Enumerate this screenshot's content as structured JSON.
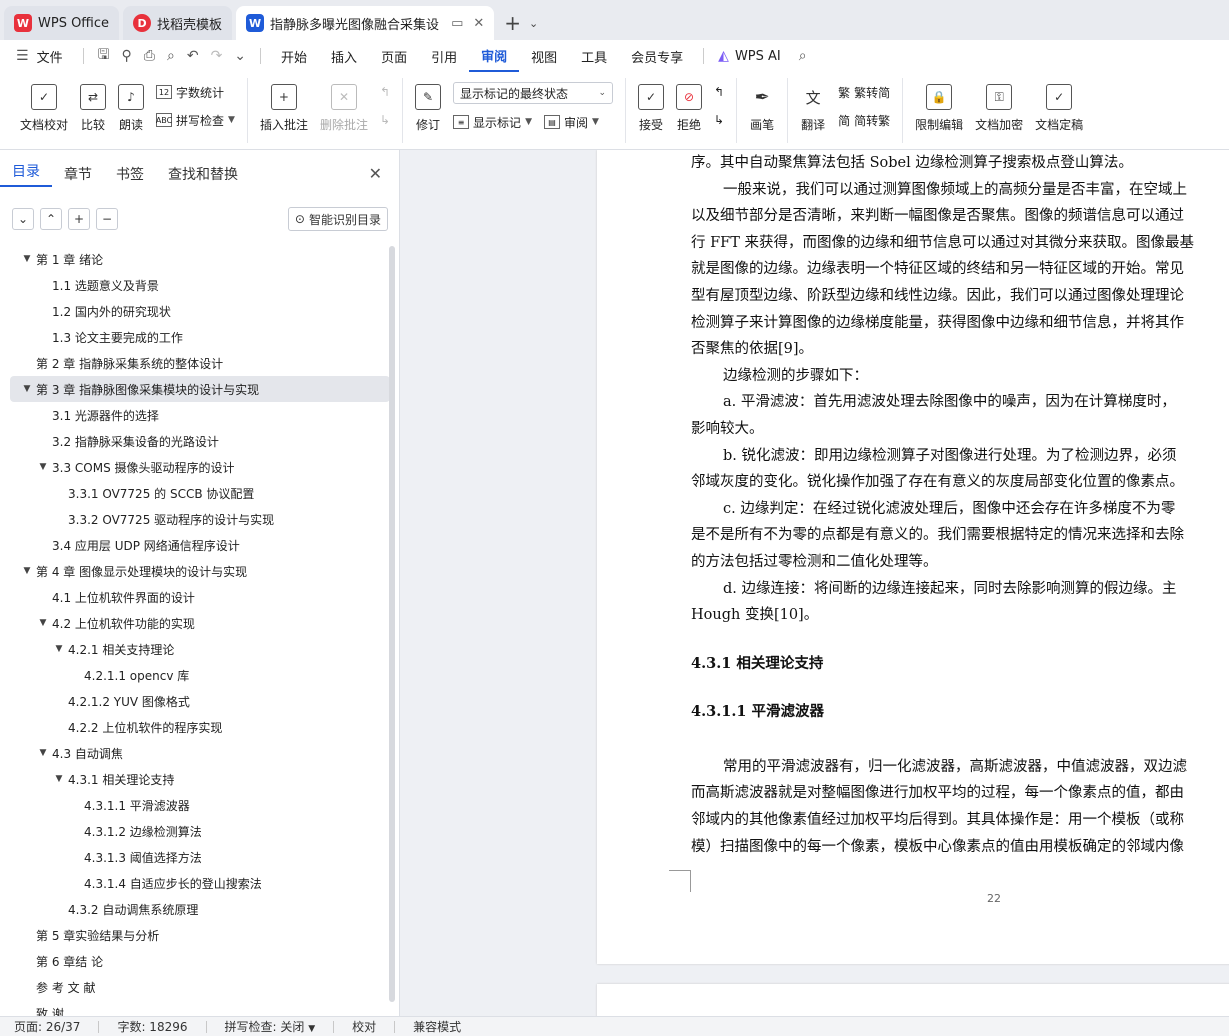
{
  "titlebar": {
    "tabs": [
      {
        "label": "WPS Office",
        "icon": "wps-logo-icon"
      },
      {
        "label": "找稻壳模板",
        "icon": "docer-logo-icon"
      },
      {
        "label": "指静脉多曝光图像融合采集设",
        "icon": "wps-writer-icon"
      }
    ],
    "new_tab": "+"
  },
  "menubar": {
    "file": "文件",
    "items": [
      "开始",
      "插入",
      "页面",
      "引用",
      "审阅",
      "视图",
      "工具",
      "会员专享"
    ],
    "active": "审阅",
    "ai": "WPS AI"
  },
  "ribbon": {
    "doc_check": "文档校对",
    "compare": "比较",
    "read_aloud": "朗读",
    "word_count": "字数统计",
    "spell_check": "拼写检查",
    "insert_comment": "插入批注",
    "delete_comment": "删除批注",
    "revise": "修订",
    "markup_state": "显示标记的最终状态",
    "show_markup": "显示标记",
    "review": "审阅",
    "accept": "接受",
    "reject": "拒绝",
    "pen": "画笔",
    "translate": "翻译",
    "trad_to_simp": "繁转简",
    "simp_to_trad": "简转繁",
    "restrict_edit": "限制编辑",
    "doc_encrypt": "文档加密",
    "doc_finalize": "文档定稿",
    "trad_char": "繁",
    "simp_char": "简"
  },
  "sidebar": {
    "tabs": [
      "目录",
      "章节",
      "书签",
      "查找和替换"
    ],
    "active_tab": "目录",
    "smart_toc": "智能识别目录",
    "toc": [
      {
        "level": 1,
        "arrow": "▼",
        "label": "第 1 章  绪论"
      },
      {
        "level": 2,
        "arrow": "",
        "label": "1.1  选题意义及背景"
      },
      {
        "level": 2,
        "arrow": "",
        "label": "1.2  国内外的研究现状"
      },
      {
        "level": 2,
        "arrow": "",
        "label": "1.3  论文主要完成的工作"
      },
      {
        "level": 1,
        "arrow": "",
        "label": "第 2 章  指静脉采集系统的整体设计"
      },
      {
        "level": 1,
        "arrow": "▼",
        "label": "第 3 章  指静脉图像采集模块的设计与实现",
        "selected": true
      },
      {
        "level": 2,
        "arrow": "",
        "label": "3.1  光源器件的选择"
      },
      {
        "level": 2,
        "arrow": "",
        "label": "3.2  指静脉采集设备的光路设计"
      },
      {
        "level": 2,
        "arrow": "▼",
        "label": "3.3 COMS 摄像头驱动程序的设计"
      },
      {
        "level": 3,
        "arrow": "",
        "label": "3.3.1 OV7725 的 SCCB 协议配置"
      },
      {
        "level": 3,
        "arrow": "",
        "label": "3.3.2 OV7725 驱动程序的设计与实现"
      },
      {
        "level": 2,
        "arrow": "",
        "label": "3.4  应用层 UDP 网络通信程序设计"
      },
      {
        "level": 1,
        "arrow": "▼",
        "label": "第 4 章  图像显示处理模块的设计与实现"
      },
      {
        "level": 2,
        "arrow": "",
        "label": "4.1  上位机软件界面的设计"
      },
      {
        "level": 2,
        "arrow": "▼",
        "label": "4.2  上位机软件功能的实现"
      },
      {
        "level": 3,
        "arrow": "▼",
        "label": "4.2.1  相关支持理论"
      },
      {
        "level": 4,
        "arrow": "",
        "label": "4.2.1.1 opencv 库"
      },
      {
        "level": 3,
        "arrow": "",
        "label": "4.2.1.2 YUV 图像格式"
      },
      {
        "level": 3,
        "arrow": "",
        "label": "4.2.2  上位机软件的程序实现"
      },
      {
        "level": 2,
        "arrow": "▼",
        "label": "4.3  自动调焦"
      },
      {
        "level": 3,
        "arrow": "▼",
        "label": "4.3.1  相关理论支持"
      },
      {
        "level": 4,
        "arrow": "",
        "label": "4.3.1.1  平滑滤波器"
      },
      {
        "level": 4,
        "arrow": "",
        "label": "4.3.1.2  边缘检测算法"
      },
      {
        "level": 4,
        "arrow": "",
        "label": "4.3.1.3  阈值选择方法"
      },
      {
        "level": 4,
        "arrow": "",
        "label": "4.3.1.4  自适应步长的登山搜索法"
      },
      {
        "level": 3,
        "arrow": "",
        "label": "4.3.2 自动调焦系统原理"
      },
      {
        "level": 1,
        "arrow": "",
        "label": "第 5 章实验结果与分析"
      },
      {
        "level": 1,
        "arrow": "",
        "label": "第 6 章结  论"
      },
      {
        "level": 1,
        "arrow": "",
        "label": "参  考  文  献"
      },
      {
        "level": 1,
        "arrow": "",
        "label": "致  谢"
      }
    ]
  },
  "document": {
    "lines": [
      {
        "text": "序。其中自动聚焦算法包括 Sobel 边缘检测算子搜索极点登山算法。",
        "indent": false
      },
      {
        "text": "一般来说，我们可以通过测算图像频域上的高频分量是否丰富，在空域上",
        "indent": true
      },
      {
        "text": "以及细节部分是否清晰，来判断一幅图像是否聚焦。图像的频谱信息可以通过",
        "indent": false
      },
      {
        "text": "行 FFT 来获得，而图像的边缘和细节信息可以通过对其微分来获取。图像最基",
        "indent": false
      },
      {
        "text": "就是图像的边缘。边缘表明一个特征区域的终结和另一特征区域的开始。常见",
        "indent": false
      },
      {
        "text": "型有屋顶型边缘、阶跃型边缘和线性边缘。因此，我们可以通过图像处理理论",
        "indent": false
      },
      {
        "text": "检测算子来计算图像的边缘梯度能量，获得图像中边缘和细节信息，并将其作",
        "indent": false
      },
      {
        "text": "否聚焦的依据[9]。",
        "indent": false
      },
      {
        "text": "边缘检测的步骤如下：",
        "indent": true
      },
      {
        "text": "a.  平滑滤波：首先用滤波处理去除图像中的噪声，因为在计算梯度时，",
        "indent": true
      },
      {
        "text": "影响较大。",
        "indent": false
      },
      {
        "text": "b.  锐化滤波：即用边缘检测算子对图像进行处理。为了检测边界，必须",
        "indent": true
      },
      {
        "text": "邻域灰度的变化。锐化操作加强了存在有意义的灰度局部变化位置的像素点。",
        "indent": false
      },
      {
        "text": "c.  边缘判定：在经过锐化滤波处理后，图像中还会存在许多梯度不为零",
        "indent": true
      },
      {
        "text": "是不是所有不为零的点都是有意义的。我们需要根据特定的情况来选择和去除",
        "indent": false
      },
      {
        "text": "的方法包括过零检测和二值化处理等。",
        "indent": false
      },
      {
        "text": "d.  边缘连接：将间断的边缘连接起来，同时去除影响测算的假边缘。主",
        "indent": true
      },
      {
        "text": "Hough 变换[10]。",
        "indent": false
      }
    ],
    "heading1": "4.3.1  相关理论支持",
    "heading2": "4.3.1.1  平滑滤波器",
    "lines2": [
      {
        "text": "常用的平滑滤波器有，归一化滤波器，高斯滤波器，中值滤波器，双边滤",
        "indent": true
      },
      {
        "text": "而高斯滤波器就是对整幅图像进行加权平均的过程，每一个像素点的值，都由",
        "indent": false
      },
      {
        "text": "邻域内的其他像素值经过加权平均后得到。其具体操作是：用一个模板（或称",
        "indent": false
      },
      {
        "text": "模）扫描图像中的每一个像素，模板中心像素点的值由用模板确定的邻域内像",
        "indent": false
      }
    ],
    "page_number": "22"
  },
  "status": {
    "page": "页面: 26/37",
    "words": "字数: 18296",
    "spell": "拼写检查: 关闭",
    "proof": "校对",
    "compat": "兼容模式"
  },
  "colors": {
    "accent": "#1f5bd8",
    "wps_red": "#e8313c"
  }
}
